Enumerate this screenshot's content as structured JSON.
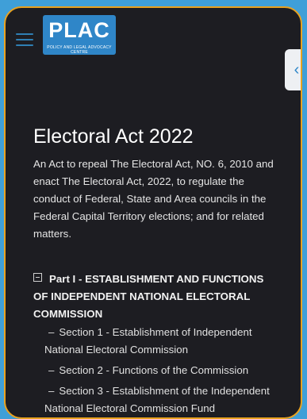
{
  "header": {
    "logo_title": "PLAC",
    "logo_subtitle": "POLICY AND LEGAL ADVOCACY CENTRE",
    "side_tab_glyph": "‹"
  },
  "page": {
    "title": "Electoral Act 2022",
    "description": "An Act to repeal The Electoral Act, NO. 6, 2010 and enact The Electoral Act, 2022, to regulate the conduct of Federal, State and Area councils in the Federal Capital Territory elections; and for related matters."
  },
  "toc": {
    "part_label": "Part I - ESTABLISHMENT AND FUNCTIONS OF INDEPENDENT NATIONAL ELECTORAL COMMISSION",
    "sections": [
      {
        "label": "Section 1 - Establishment of Independent National Electoral Commission"
      },
      {
        "label": "Section 2 - Functions of the Commission"
      },
      {
        "label": "Section 3 - Establishment of the Independent National Electoral Commission Fund"
      }
    ]
  },
  "colors": {
    "background": "#3f9fd8",
    "device_frame": "#e9a21f",
    "screen": "#1d1d22",
    "brand": "#2f86c8"
  }
}
